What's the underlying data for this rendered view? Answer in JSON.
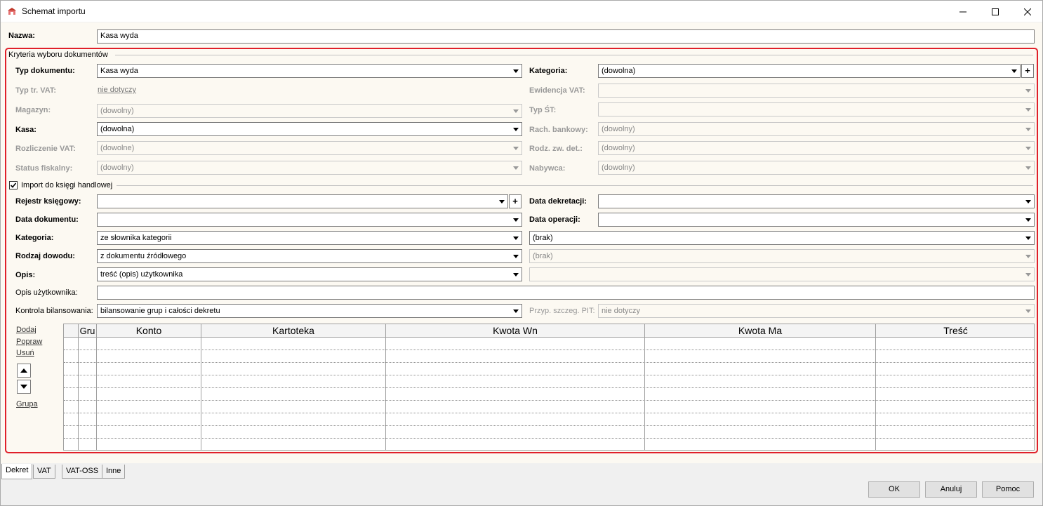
{
  "window": {
    "title": "Schemat importu"
  },
  "name": {
    "label": "Nazwa:",
    "value": "Kasa wyda"
  },
  "criteria": {
    "legend": "Kryteria wyboru dokumentów",
    "typ_dokumentu": {
      "label": "Typ dokumentu:",
      "value": "Kasa wyda"
    },
    "kategoria": {
      "label": "Kategoria:",
      "value": "(dowolna)"
    },
    "typ_tr_vat": {
      "label": "Typ tr. VAT:",
      "value": "nie dotyczy"
    },
    "ewidencja_vat": {
      "label": "Ewidencja VAT:",
      "value": ""
    },
    "magazyn": {
      "label": "Magazyn:",
      "value": "(dowolny)"
    },
    "typ_st": {
      "label": "Typ ŚT:",
      "value": ""
    },
    "kasa": {
      "label": "Kasa:",
      "value": "(dowolna)"
    },
    "rach_bankowy": {
      "label": "Rach. bankowy:",
      "value": "(dowolny)"
    },
    "rozliczenie_vat": {
      "label": "Rozliczenie VAT:",
      "value": "(dowolne)"
    },
    "rodz_zw_det": {
      "label": "Rodz. zw. det.:",
      "value": "(dowolny)"
    },
    "status_fiskalny": {
      "label": "Status fiskalny:",
      "value": "(dowolny)"
    },
    "nabywca": {
      "label": "Nabywca:",
      "value": "(dowolny)"
    }
  },
  "import": {
    "checkbox_label": "Import do księgi handlowej",
    "checked": true,
    "rejestr": {
      "label": "Rejestr księgowy:",
      "value": ""
    },
    "data_dekretacji": {
      "label": "Data dekretacji:",
      "value": ""
    },
    "data_dokumentu": {
      "label": "Data dokumentu:",
      "value": ""
    },
    "data_operacji": {
      "label": "Data operacji:",
      "value": ""
    },
    "kategoria": {
      "label": "Kategoria:",
      "value": "ze słownika kategorii",
      "value2": "(brak)"
    },
    "rodzaj_dowodu": {
      "label": "Rodzaj dowodu:",
      "value": "z dokumentu źródłowego",
      "value2": "(brak)"
    },
    "opis": {
      "label": "Opis:",
      "value": "treść (opis) użytkownika",
      "value2": ""
    },
    "opis_uzytkownika": {
      "label": "Opis użytkownika:",
      "value": ""
    },
    "kontrola": {
      "label": "Kontrola bilansowania:",
      "value": "bilansowanie grup i całości dekretu"
    },
    "przyp_pit": {
      "label": "Przyp. szczeg. PIT:",
      "value": "nie dotyczy"
    }
  },
  "actions": {
    "dodaj": "Dodaj",
    "popraw": "Popraw",
    "usun": "Usuń",
    "grupa": "Grupa"
  },
  "table": {
    "columns": [
      "",
      "Gru",
      "Konto",
      "Kartoteka",
      "Kwota Wn",
      "Kwota Ma",
      "Treść"
    ],
    "rows": 8
  },
  "tabs": [
    "Dekret",
    "VAT",
    "VAT-OSS",
    "Inne"
  ],
  "buttons": {
    "ok": "OK",
    "anuluj": "Anuluj",
    "pomoc": "Pomoc"
  },
  "colors": {
    "highlight": "#e0202a",
    "panel": "#fcf9f2"
  }
}
